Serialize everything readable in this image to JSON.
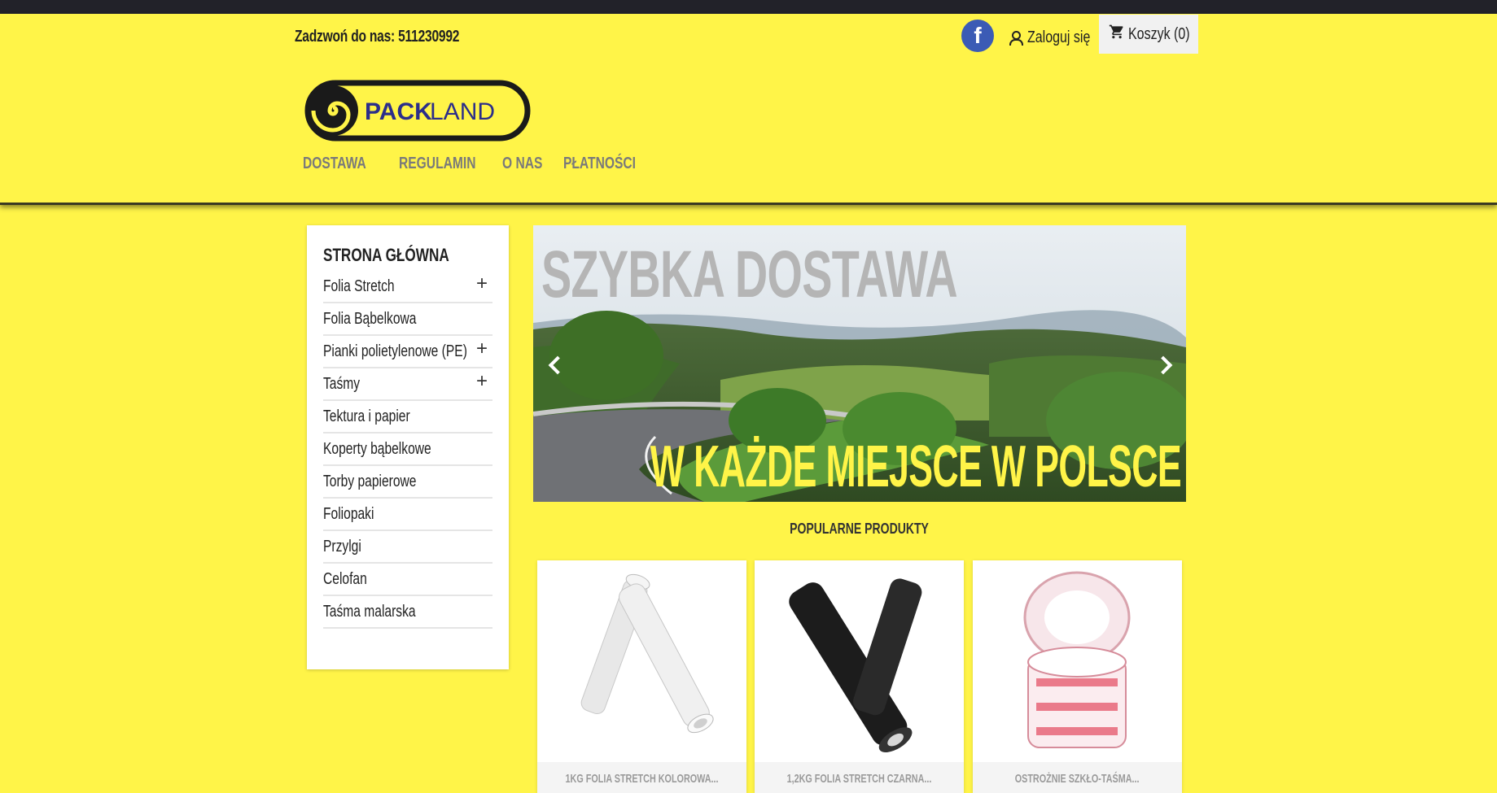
{
  "header": {
    "call_text": "Zadzwoń do nas: 511230992",
    "facebook_letter": "f",
    "login_label": "Zaloguj się",
    "cart_label": "Koszyk (0)",
    "logo_text_pack": "PACK",
    "logo_text_land": "LAND"
  },
  "nav": {
    "items": [
      "DOSTAWA",
      "REGULAMIN",
      "O NAS",
      "PŁATNOŚCI"
    ]
  },
  "sidebar": {
    "title": "STRONA GŁÓWNA",
    "categories": [
      {
        "label": "Folia Stretch",
        "expand": "+"
      },
      {
        "label": "Folia Bąbelkowa",
        "expand": ""
      },
      {
        "label": "Pianki polietylenowe (PE)",
        "expand": "+"
      },
      {
        "label": "Taśmy",
        "expand": "+"
      },
      {
        "label": "Tektura i papier",
        "expand": ""
      },
      {
        "label": "Koperty bąbelkowe",
        "expand": ""
      },
      {
        "label": "Torby papierowe",
        "expand": ""
      },
      {
        "label": "Foliopaki",
        "expand": ""
      },
      {
        "label": "Przylgi",
        "expand": ""
      },
      {
        "label": "Celofan",
        "expand": ""
      },
      {
        "label": "Taśma malarska",
        "expand": ""
      }
    ]
  },
  "slider": {
    "heading": "SZYBKA DOSTAWA",
    "subheading": "W KAŻDE MIEJSCE W POLSCE"
  },
  "popular": {
    "title": "POPULARNE PRODUKTY",
    "products": [
      {
        "name": "1KG FOLIA STRETCH KOLOROWA..."
      },
      {
        "name": "1,2KG FOLIA STRETCH CZARNA..."
      },
      {
        "name": "OSTROŻNIE SZKŁO-TAŚMA..."
      }
    ]
  },
  "colors": {
    "brand_yellow": "#fff448",
    "logo_blue": "#2c2e8a"
  }
}
